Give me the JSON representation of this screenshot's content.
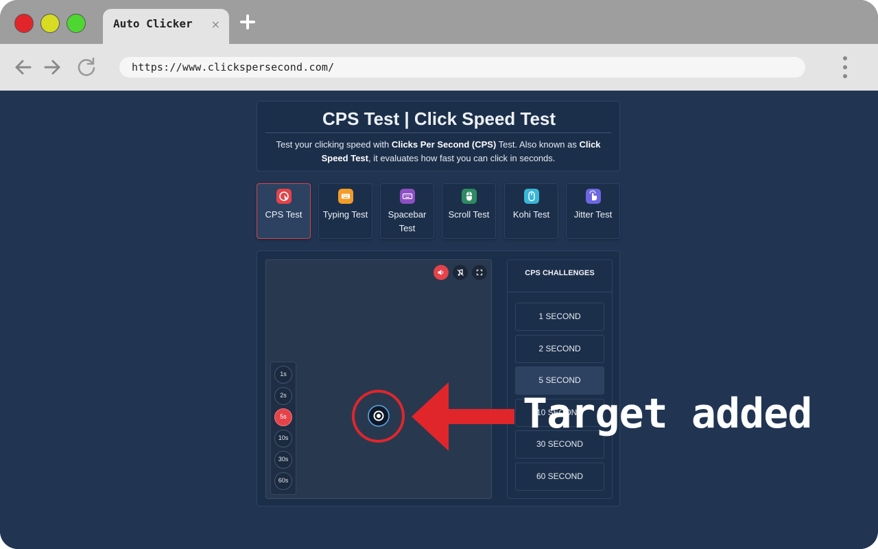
{
  "browser": {
    "tab_title": "Auto Clicker",
    "tab_close": "×",
    "url": "https://www.clickspersecond.com/"
  },
  "header": {
    "title": "CPS Test | Click Speed Test",
    "desc_1": "Test your clicking speed with ",
    "desc_bold_1": "Clicks Per Second (CPS)",
    "desc_2": " Test. Also known as ",
    "desc_bold_2": "Click Speed Test",
    "desc_3": ", it evaluates how fast you can click in seconds."
  },
  "test_tabs": [
    {
      "label": "CPS Test",
      "icon": "cursor-click-icon",
      "color": "#e4434a"
    },
    {
      "label": "Typing Test",
      "icon": "keyboard-icon",
      "color": "#f39c2a"
    },
    {
      "label": "Spacebar Test",
      "icon": "spacebar-icon",
      "color": "#8d4fc4"
    },
    {
      "label": "Scroll Test",
      "icon": "mouse-icon",
      "color": "#2f8a64"
    },
    {
      "label": "Kohi Test",
      "icon": "kohi-mouse-icon",
      "color": "#38b6d8"
    },
    {
      "label": "Jitter Test",
      "icon": "hand-pointer-icon",
      "color": "#6d66e0"
    }
  ],
  "time_options": [
    {
      "label": "1s",
      "active": false
    },
    {
      "label": "2s",
      "active": false
    },
    {
      "label": "5s",
      "active": true
    },
    {
      "label": "10s",
      "active": false
    },
    {
      "label": "30s",
      "active": false
    },
    {
      "label": "60s",
      "active": false
    }
  ],
  "challenges": {
    "title": "CPS CHALLENGES",
    "items": [
      "1 SECOND",
      "2 SECOND",
      "5 SECOND",
      "10 SECOND",
      "30 SECOND",
      "60 SECOND"
    ]
  },
  "annotation": {
    "text": "Target added",
    "color": "#e0262b"
  }
}
